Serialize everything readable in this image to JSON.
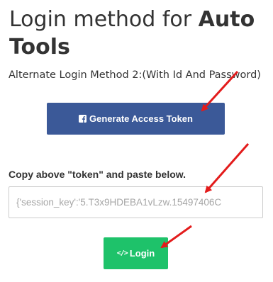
{
  "title": {
    "prefix": "Login method for ",
    "bold_part": "Auto",
    "second_line": "Tools"
  },
  "subtitle": "Alternate Login Method 2:(With Id And Password)",
  "generate_button": {
    "label": "Generate Access Token",
    "icon": "facebook-icon"
  },
  "copy_label": "Copy above \"token\" and paste below.",
  "token_input": {
    "value": "{'session_key':'5.T3x9HDEBA1vLzw.15497406C"
  },
  "login_button": {
    "label": "Login",
    "icon": "code-icon"
  },
  "colors": {
    "facebook_blue": "#3b5998",
    "login_green": "#1ec26a",
    "annotation_arrow": "#e31b1b"
  }
}
